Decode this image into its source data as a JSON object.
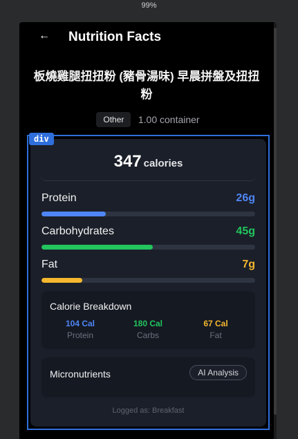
{
  "browser": {
    "zoom": "99%"
  },
  "header": {
    "back_icon": "←",
    "title": "Nutrition Facts"
  },
  "food": {
    "name": "板燒雞腿扭扭粉 (豬骨湯味) 早晨拼盤及扭扭粉",
    "category": "Other",
    "serving": "1.00 container"
  },
  "inspector": {
    "tag": "div"
  },
  "calories": {
    "value": "347",
    "unit": "calories"
  },
  "macros": [
    {
      "name": "Protein",
      "amount": "26g",
      "color": "#4f86f7",
      "fill_fraction": 0.3
    },
    {
      "name": "Carbohydrates",
      "amount": "45g",
      "color": "#22c55e",
      "fill_fraction": 0.52
    },
    {
      "name": "Fat",
      "amount": "7g",
      "color": "#f5b82e",
      "fill_fraction": 0.19
    }
  ],
  "breakdown": {
    "title": "Calorie Breakdown",
    "items": [
      {
        "value": "104 Cal",
        "label": "Protein",
        "color": "#4f86f7"
      },
      {
        "value": "180 Cal",
        "label": "Carbs",
        "color": "#22c55e"
      },
      {
        "value": "67 Cal",
        "label": "Fat",
        "color": "#f5b82e"
      }
    ]
  },
  "micronutrients": {
    "title": "Micronutrients",
    "button_label": "AI Analysis"
  },
  "footer": {
    "logged_as": "Logged as: Breakfast"
  }
}
